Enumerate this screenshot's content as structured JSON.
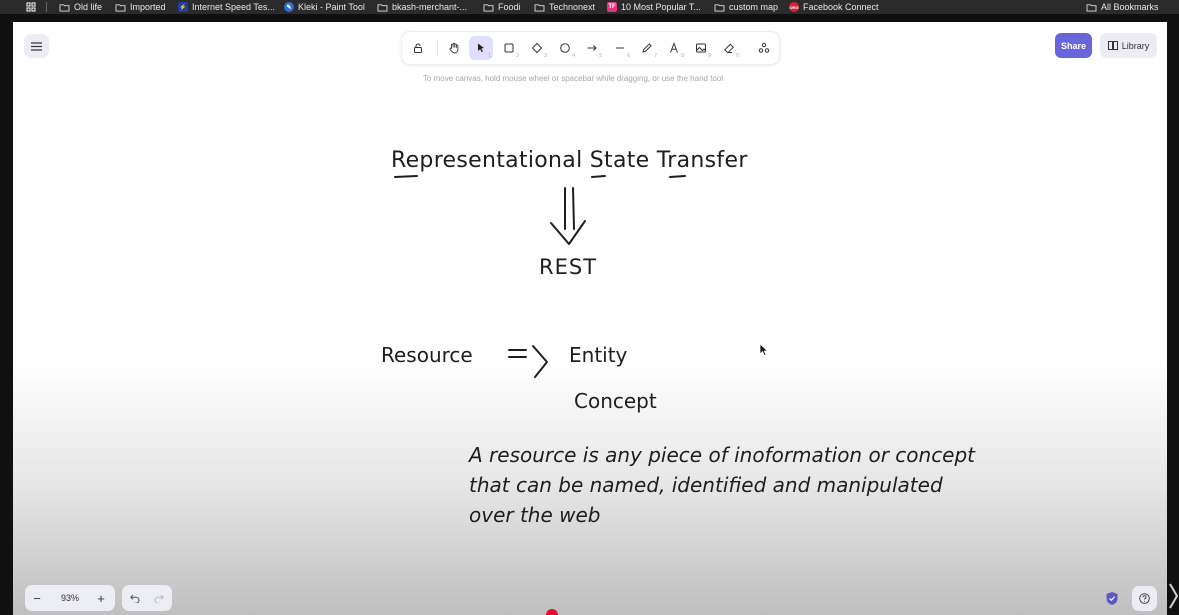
{
  "bookmarks": {
    "items": [
      {
        "label": "Old life"
      },
      {
        "label": "Imported"
      },
      {
        "label": "Internet Speed Tes..."
      },
      {
        "label": "Kleki - Paint Tool"
      },
      {
        "label": "bkash-merchant-..."
      },
      {
        "label": "Foodi"
      },
      {
        "label": "Technonext"
      },
      {
        "label": "10 Most Popular T...",
        "badge": "TF"
      },
      {
        "label": "custom map"
      },
      {
        "label": "Facebook Connect",
        "badge": "ORG"
      }
    ],
    "all_bookmarks": "All Bookmarks"
  },
  "toolbar": {
    "tools": [
      {
        "name": "lock",
        "key": ""
      },
      {
        "name": "hand",
        "key": ""
      },
      {
        "name": "selection",
        "key": "1"
      },
      {
        "name": "rectangle",
        "key": "2"
      },
      {
        "name": "diamond",
        "key": "3"
      },
      {
        "name": "ellipse",
        "key": "4"
      },
      {
        "name": "arrow",
        "key": "5"
      },
      {
        "name": "line",
        "key": "6"
      },
      {
        "name": "draw",
        "key": "7"
      },
      {
        "name": "text",
        "key": "8"
      },
      {
        "name": "image",
        "key": "9"
      },
      {
        "name": "eraser",
        "key": "0"
      },
      {
        "name": "extra-tools",
        "key": ""
      }
    ],
    "active_tool": "selection"
  },
  "hint": "To move canvas, hold mouse wheel or spacebar while dragging, or use the hand tool",
  "header": {
    "share_label": "Share",
    "library_label": "Library"
  },
  "canvas": {
    "title": "Representational State Transfer",
    "abbrev": "REST",
    "resource": "Resource",
    "entity": "Entity",
    "concept": "Concept",
    "definition": [
      "A resource is any piece of inoformation or concept",
      "that can be named, identified and manipulated",
      "over the web"
    ]
  },
  "footer": {
    "zoom": "93%",
    "zoom_out": "−",
    "zoom_in": "+"
  },
  "colors": {
    "accent": "#6965db",
    "active_tool_bg": "#e0dfff",
    "ink": "#1e1e1e"
  }
}
